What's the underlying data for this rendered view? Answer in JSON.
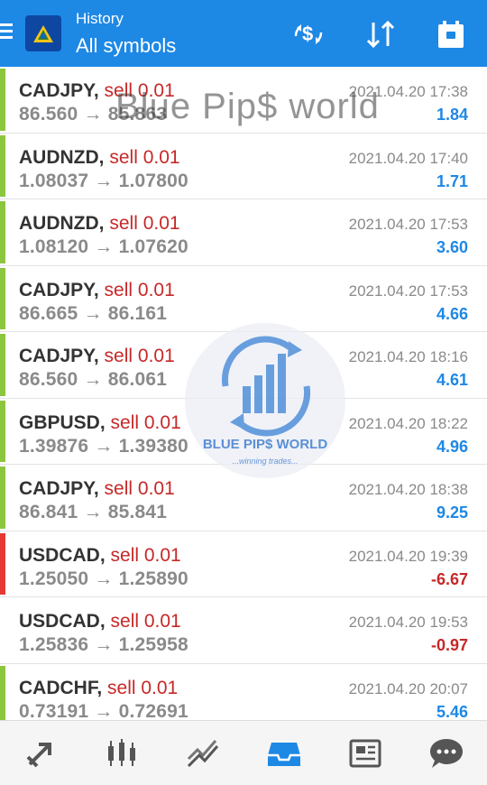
{
  "header": {
    "title_small": "History",
    "title_big": "All symbols",
    "actions": [
      "currency-icon",
      "sort-icon",
      "calendar-icon"
    ],
    "bg_color": "#1e88e5"
  },
  "watermark": {
    "text": "Blue Pip$ world",
    "logo_name": "BLUE PIP$ WORLD",
    "logo_tagline": "...winning trades..."
  },
  "trades": [
    {
      "symbol": "CADJPY,",
      "type": "sell 0.01",
      "open": "86.560",
      "close": "85.863",
      "arrow": "→",
      "time": "2021.04.20 17:38",
      "profit": "1.84",
      "status": "profit"
    },
    {
      "symbol": "AUDNZD,",
      "type": "sell 0.01",
      "open": "1.08037",
      "close": "1.07800",
      "arrow": "→",
      "time": "2021.04.20 17:40",
      "profit": "1.71",
      "status": "profit"
    },
    {
      "symbol": "AUDNZD,",
      "type": "sell 0.01",
      "open": "1.08120",
      "close": "1.07620",
      "arrow": "→",
      "time": "2021.04.20 17:53",
      "profit": "3.60",
      "status": "profit"
    },
    {
      "symbol": "CADJPY,",
      "type": "sell 0.01",
      "open": "86.665",
      "close": "86.161",
      "arrow": "→",
      "time": "2021.04.20 17:53",
      "profit": "4.66",
      "status": "profit"
    },
    {
      "symbol": "CADJPY,",
      "type": "sell 0.01",
      "open": "86.560",
      "close": "86.061",
      "arrow": "→",
      "time": "2021.04.20 18:16",
      "profit": "4.61",
      "status": "profit"
    },
    {
      "symbol": "GBPUSD,",
      "type": "sell 0.01",
      "open": "1.39876",
      "close": "1.39380",
      "arrow": "→",
      "time": "2021.04.20 18:22",
      "profit": "4.96",
      "status": "profit"
    },
    {
      "symbol": "CADJPY,",
      "type": "sell 0.01",
      "open": "86.841",
      "close": "85.841",
      "arrow": "→",
      "time": "2021.04.20 18:38",
      "profit": "9.25",
      "status": "profit"
    },
    {
      "symbol": "USDCAD,",
      "type": "sell 0.01",
      "open": "1.25050",
      "close": "1.25890",
      "arrow": "→",
      "time": "2021.04.20 19:39",
      "profit": "-6.67",
      "status": "loss"
    },
    {
      "symbol": "USDCAD,",
      "type": "sell 0.01",
      "open": "1.25836",
      "close": "1.25958",
      "arrow": "→",
      "time": "2021.04.20 19:53",
      "profit": "-0.97",
      "status": "loss-small"
    },
    {
      "symbol": "CADCHF,",
      "type": "sell 0.01",
      "open": "0.73191",
      "close": "0.72691",
      "arrow": "→",
      "time": "2021.04.20 20:07",
      "profit": "5.46",
      "status": "profit"
    }
  ],
  "bar_colors": {
    "profit": "#8cc63f",
    "loss": "#e53935",
    "loss-small": "#ffffff"
  },
  "bottom_nav": [
    "trade-arrow-icon",
    "candlestick-chart-icon",
    "trend-chart-icon",
    "history-inbox-icon",
    "news-icon",
    "chat-icon"
  ],
  "colors": {
    "accent": "#1e88e5",
    "positive": "#1e88e5",
    "negative": "#c62828",
    "active_nav": "#1e88e5",
    "inactive_nav": "#555555"
  }
}
